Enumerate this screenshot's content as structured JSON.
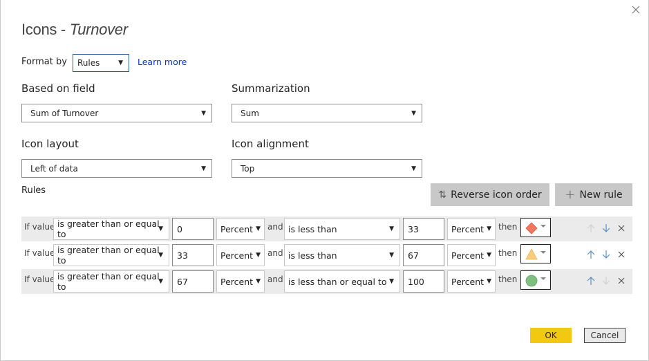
{
  "dialog": {
    "title_prefix": "Icons - ",
    "title_field": "Turnover",
    "close_icon": "close-icon"
  },
  "format_by": {
    "label": "Format by",
    "value": "Rules",
    "learn_more": "Learn more"
  },
  "based_on_field": {
    "label": "Based on field",
    "value": "Sum of Turnover"
  },
  "summarization": {
    "label": "Summarization",
    "value": "Sum"
  },
  "icon_layout": {
    "label": "Icon layout",
    "value": "Left of data"
  },
  "icon_alignment": {
    "label": "Icon alignment",
    "value": "Top"
  },
  "rules": {
    "label": "Rules",
    "reverse_button": "Reverse icon order",
    "reverse_icon": "sort-arrows-icon",
    "new_rule_button": "New rule",
    "new_rule_icon": "plus-icon",
    "items": [
      {
        "if_label": "If value",
        "op1": "is greater than or equal to",
        "val1": "0",
        "type1": "Percent",
        "and_label": "and",
        "op2": "is less than",
        "val2": "33",
        "type2": "Percent",
        "then_label": "then",
        "icon": "red-diamond",
        "icon_color": "#f1775f",
        "up_enabled": false,
        "down_enabled": true
      },
      {
        "if_label": "If value",
        "op1": "is greater than or equal to",
        "val1": "33",
        "type1": "Percent",
        "and_label": "and",
        "op2": "is less than",
        "val2": "67",
        "type2": "Percent",
        "then_label": "then",
        "icon": "yellow-triangle",
        "icon_color": "#f9cd7a",
        "up_enabled": true,
        "down_enabled": true
      },
      {
        "if_label": "If value",
        "op1": "is greater than or equal to",
        "val1": "67",
        "type1": "Percent",
        "and_label": "and",
        "op2": "is less than or equal to",
        "val2": "100",
        "type2": "Percent",
        "then_label": "then",
        "icon": "green-circle",
        "icon_color": "#7fbf7f",
        "up_enabled": true,
        "down_enabled": false
      }
    ]
  },
  "footer": {
    "ok": "OK",
    "cancel": "Cancel"
  },
  "colors": {
    "ok_button": "#f2c811",
    "link": "#0e2fe0",
    "shaded_row": "#ebebeb",
    "gray_button": "#c8c8c8"
  }
}
